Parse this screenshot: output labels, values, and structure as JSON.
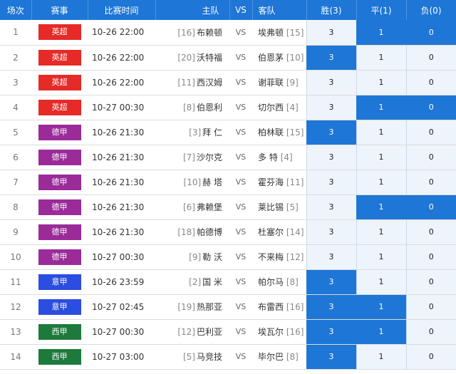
{
  "colors": {
    "header_bg": "#1e76d6",
    "selected_bg": "#1e76d6",
    "odd_bg": "#eef4fb",
    "league_英超": "#e62a27",
    "league_德甲": "#9a2b99",
    "league_意甲": "#2b4de0",
    "league_西甲": "#1d7a3b"
  },
  "headers": {
    "idx": "场次",
    "league": "赛事",
    "time": "比赛时间",
    "home": "主队",
    "vs": "VS",
    "away": "客队",
    "win": "胜(3)",
    "draw": "平(1)",
    "lose": "负(0)"
  },
  "rows": [
    {
      "idx": "1",
      "league": "英超",
      "league_color": "#e62a27",
      "time": "10-26 22:00",
      "home_rank": "[16]",
      "home": "布赖顿",
      "vs": "VS",
      "away": "埃弗顿",
      "away_rank": "[15]",
      "win": "3",
      "draw": "1",
      "lose": "0",
      "sel": [
        false,
        true,
        true
      ]
    },
    {
      "idx": "2",
      "league": "英超",
      "league_color": "#e62a27",
      "time": "10-26 22:00",
      "home_rank": "[20]",
      "home": "沃特福",
      "vs": "VS",
      "away": "伯恩茅",
      "away_rank": "[10]",
      "win": "3",
      "draw": "1",
      "lose": "0",
      "sel": [
        true,
        false,
        false
      ]
    },
    {
      "idx": "3",
      "league": "英超",
      "league_color": "#e62a27",
      "time": "10-26 22:00",
      "home_rank": "[11]",
      "home": "西汉姆",
      "vs": "VS",
      "away": "谢菲联",
      "away_rank": "[9]",
      "win": "3",
      "draw": "1",
      "lose": "0",
      "sel": [
        false,
        false,
        false
      ]
    },
    {
      "idx": "4",
      "league": "英超",
      "league_color": "#e62a27",
      "time": "10-27 00:30",
      "home_rank": "[8]",
      "home": "伯恩利",
      "vs": "VS",
      "away": "切尔西",
      "away_rank": "[4]",
      "win": "3",
      "draw": "1",
      "lose": "0",
      "sel": [
        false,
        true,
        true
      ]
    },
    {
      "idx": "5",
      "league": "德甲",
      "league_color": "#9a2b99",
      "time": "10-26 21:30",
      "home_rank": "[3]",
      "home": "拜 仁",
      "vs": "VS",
      "away": "柏林联",
      "away_rank": "[15]",
      "win": "3",
      "draw": "1",
      "lose": "0",
      "sel": [
        true,
        false,
        false
      ]
    },
    {
      "idx": "6",
      "league": "德甲",
      "league_color": "#9a2b99",
      "time": "10-26 21:30",
      "home_rank": "[7]",
      "home": "沙尔克",
      "vs": "VS",
      "away": "多 特",
      "away_rank": "[4]",
      "win": "3",
      "draw": "1",
      "lose": "0",
      "sel": [
        false,
        false,
        false
      ]
    },
    {
      "idx": "7",
      "league": "德甲",
      "league_color": "#9a2b99",
      "time": "10-26 21:30",
      "home_rank": "[10]",
      "home": "赫 塔",
      "vs": "VS",
      "away": "霍芬海",
      "away_rank": "[11]",
      "win": "3",
      "draw": "1",
      "lose": "0",
      "sel": [
        false,
        false,
        false
      ]
    },
    {
      "idx": "8",
      "league": "德甲",
      "league_color": "#9a2b99",
      "time": "10-26 21:30",
      "home_rank": "[6]",
      "home": "弗赖堡",
      "vs": "VS",
      "away": "莱比锡",
      "away_rank": "[5]",
      "win": "3",
      "draw": "1",
      "lose": "0",
      "sel": [
        false,
        true,
        true
      ]
    },
    {
      "idx": "9",
      "league": "德甲",
      "league_color": "#9a2b99",
      "time": "10-26 21:30",
      "home_rank": "[18]",
      "home": "帕德博",
      "vs": "VS",
      "away": "杜塞尔",
      "away_rank": "[14]",
      "win": "3",
      "draw": "1",
      "lose": "0",
      "sel": [
        false,
        false,
        false
      ]
    },
    {
      "idx": "10",
      "league": "德甲",
      "league_color": "#9a2b99",
      "time": "10-27 00:30",
      "home_rank": "[9]",
      "home": "勒 沃",
      "vs": "VS",
      "away": "不来梅",
      "away_rank": "[12]",
      "win": "3",
      "draw": "1",
      "lose": "0",
      "sel": [
        false,
        false,
        false
      ]
    },
    {
      "idx": "11",
      "league": "意甲",
      "league_color": "#2b4de0",
      "time": "10-26 23:59",
      "home_rank": "[2]",
      "home": "国 米",
      "vs": "VS",
      "away": "帕尔马",
      "away_rank": "[8]",
      "win": "3",
      "draw": "1",
      "lose": "0",
      "sel": [
        true,
        false,
        false
      ]
    },
    {
      "idx": "12",
      "league": "意甲",
      "league_color": "#2b4de0",
      "time": "10-27 02:45",
      "home_rank": "[19]",
      "home": "热那亚",
      "vs": "VS",
      "away": "布雷西",
      "away_rank": "[16]",
      "win": "3",
      "draw": "1",
      "lose": "0",
      "sel": [
        true,
        true,
        false
      ]
    },
    {
      "idx": "13",
      "league": "西甲",
      "league_color": "#1d7a3b",
      "time": "10-27 00:30",
      "home_rank": "[12]",
      "home": "巴利亚",
      "vs": "VS",
      "away": "埃瓦尔",
      "away_rank": "[16]",
      "win": "3",
      "draw": "1",
      "lose": "0",
      "sel": [
        true,
        true,
        false
      ]
    },
    {
      "idx": "14",
      "league": "西甲",
      "league_color": "#1d7a3b",
      "time": "10-27 03:00",
      "home_rank": "[5]",
      "home": "马竞技",
      "vs": "VS",
      "away": "毕尔巴",
      "away_rank": "[8]",
      "win": "3",
      "draw": "1",
      "lose": "0",
      "sel": [
        true,
        false,
        false
      ]
    }
  ]
}
